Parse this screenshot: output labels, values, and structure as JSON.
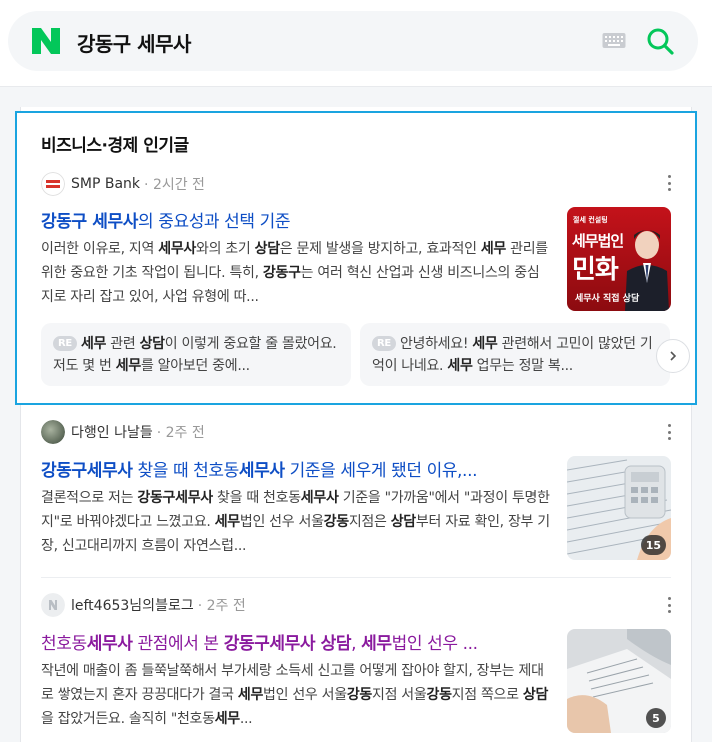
{
  "search": {
    "query": "강동구 세무사"
  },
  "section": {
    "title": "비즈니스·경제 인기글"
  },
  "posts": [
    {
      "author": "SMP Bank",
      "time": "2시간 전",
      "title_parts": [
        "강동구 세무사",
        "의 중요성과 선택 기준"
      ],
      "desc_parts": [
        "이러한 이유로, 지역 ",
        "세무사",
        "와의 초기 ",
        "상담",
        "은 문제 발생을 방지하고, 효과적인 ",
        "세무",
        " 관리를 위한 중요한 기초 작업이 됩니다. 특히, ",
        "강동구",
        "는 여러 혁신 산업과 신생 비즈니스의 중심지로 자리 잡고 있어, 사업 유형에 따..."
      ],
      "thumb": {
        "top_text": "절세 컨설팅",
        "main_text": "세무법인",
        "name_text": "민화",
        "bottom_text": "세무사 직접 상담"
      },
      "replies": [
        {
          "tag": "RE",
          "parts": [
            "",
            "세무",
            " 관련 ",
            "상담",
            "이 이렇게 중요할 줄 몰랐어요. 저도 몇 번 ",
            "세무",
            "를 알아보던 중에..."
          ]
        },
        {
          "tag": "RE",
          "parts": [
            "안녕하세요! ",
            "세무",
            " 관련해서 고민이 많았던 기억이 나네요. ",
            "세무",
            " 업무는 정말 복..."
          ]
        }
      ]
    },
    {
      "author": "다행인 나날들",
      "time": "2주 전",
      "title_parts": [
        "강동구세무사",
        " 찾을 때 천호동",
        "세무사",
        " 기준을 세우게 됐던 이유,..."
      ],
      "desc_parts": [
        "결론적으로 저는 ",
        "강동구세무사",
        " 찾을 때 천호동",
        "세무사",
        " 기준을 \"가까움\"에서 \"과정이 투명한지\"로 바꿔야겠다고 느꼈고요. ",
        "세무",
        "법인 선우 서울",
        "강동",
        "지점은 ",
        "상담",
        "부터 자료 확인, 장부 기장, 신고대리까지 흐름이 자연스럽..."
      ],
      "thumb_count": "15"
    },
    {
      "author": "left4653님의블로그",
      "time": "2주 전",
      "title_parts": [
        "천호동",
        "세무사",
        " 관점에서 본 ",
        "강동구세무사 상담",
        ", ",
        "세무",
        "법인 선우 ..."
      ],
      "desc_parts": [
        "작년에 매출이 좀 들쭉날쭉해서 부가세랑 소득세 신고를 어떻게 잡아야 할지, 장부는 제대로 쌓였는지 혼자 끙끙대다가 결국 ",
        "세무",
        "법인 선우 서울",
        "강동",
        "지점 서울",
        "강동",
        "지점 쪽으로 ",
        "상담",
        "을 잡았거든요. 솔직히 \"천호동",
        "세무",
        "..."
      ],
      "thumb_count": "5"
    }
  ],
  "icons": {
    "logo": "naver-n-logo",
    "keyboard": "keyboard-icon",
    "search": "search-icon",
    "more": "more-vertical-icon",
    "next": "chevron-right-icon"
  },
  "colors": {
    "brand_green": "#03c75a",
    "link_blue": "#0e4ec5",
    "visited_purple": "#8a1a9e",
    "highlight_border": "#1aa4e0"
  }
}
